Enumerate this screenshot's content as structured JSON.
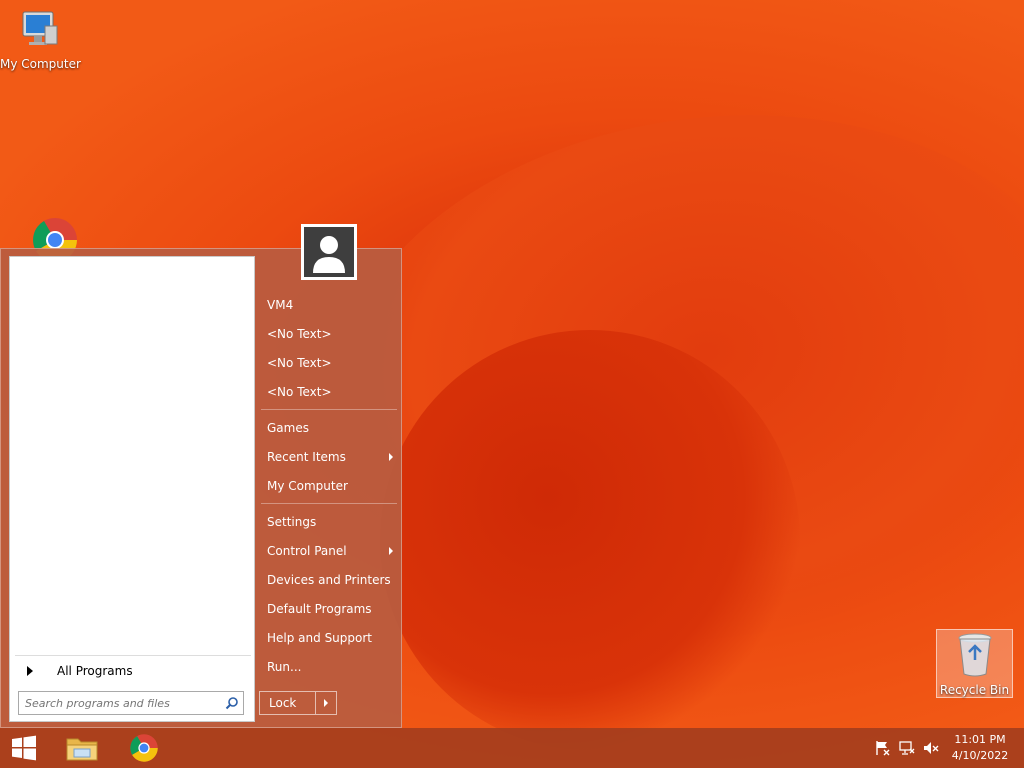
{
  "desktop": {
    "icons": [
      {
        "label": "My Computer"
      },
      {
        "label": "Recycle Bin"
      }
    ]
  },
  "start_menu": {
    "all_programs_label": "All Programs",
    "search_placeholder": "Search programs and files",
    "right_items": [
      {
        "label": "VM4"
      },
      {
        "label": "<No Text>"
      },
      {
        "label": "<No Text>"
      },
      {
        "label": "<No Text>"
      },
      {
        "label": "Games"
      },
      {
        "label": "Recent Items"
      },
      {
        "label": "My Computer"
      },
      {
        "label": "Settings"
      },
      {
        "label": "Control Panel"
      },
      {
        "label": "Devices and Printers"
      },
      {
        "label": "Default Programs"
      },
      {
        "label": "Help and Support"
      },
      {
        "label": "Run..."
      }
    ],
    "lock_label": "Lock"
  },
  "taskbar": {
    "time": "11:01 PM",
    "date": "4/10/2022",
    "tray_icons": [
      "action-center-flag-icon",
      "network-icon",
      "volume-muted-icon"
    ]
  },
  "colors": {
    "accent": "#b85c40",
    "wallpaper": "#e8440f"
  }
}
